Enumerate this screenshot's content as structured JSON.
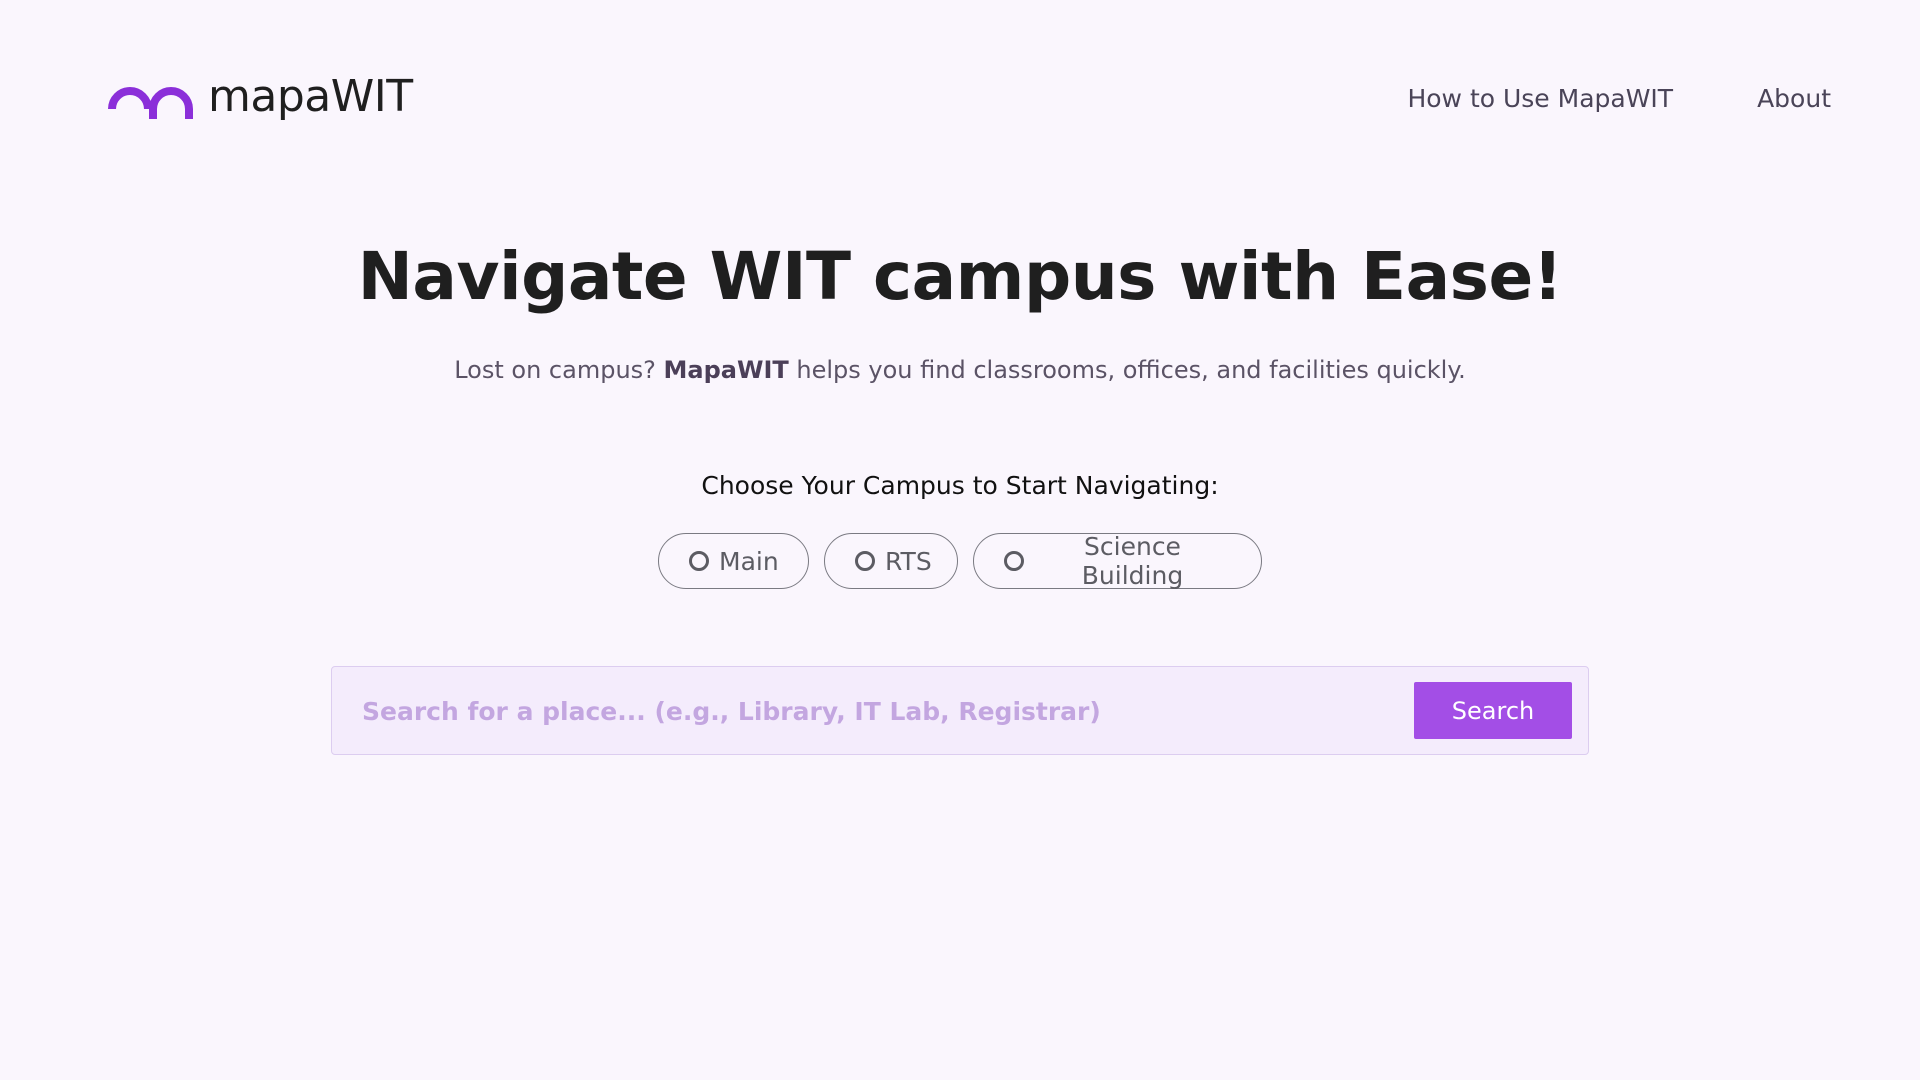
{
  "header": {
    "logo_text": "mapaWIT",
    "nav": [
      {
        "label": "How to Use MapaWIT"
      },
      {
        "label": "About"
      }
    ]
  },
  "hero": {
    "title": "Navigate WIT campus with Ease!",
    "subtitle_before": "Lost on campus? ",
    "subtitle_brand": "MapaWIT",
    "subtitle_after": " helps you find classrooms, offices, and facilities quickly."
  },
  "campus": {
    "prompt": "Choose Your Campus to Start Navigating:",
    "options": [
      {
        "label": "Main",
        "selected": false
      },
      {
        "label": "RTS",
        "selected": false
      },
      {
        "label": "Science Building",
        "selected": false
      }
    ]
  },
  "search": {
    "value": "",
    "placeholder": "Search for a place... (e.g., Library, IT Lab, Registrar)",
    "button_label": "Search"
  },
  "colors": {
    "accent": "#a34ee6",
    "logo": "#8b2fd9",
    "background": "#faf6fd"
  }
}
